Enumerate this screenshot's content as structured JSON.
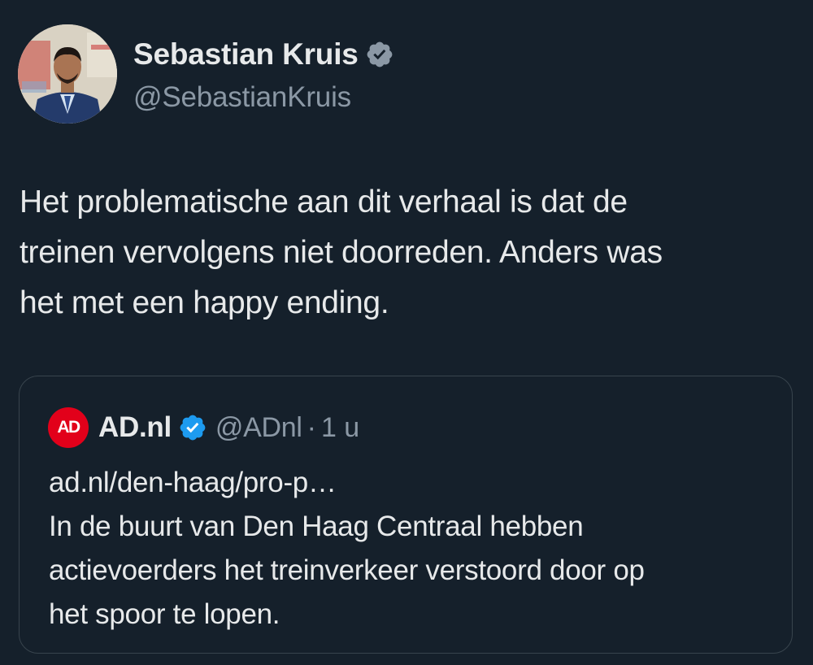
{
  "tweet": {
    "author": {
      "display_name": "Sebastian Kruis",
      "handle": "@SebastianKruis",
      "verified": true,
      "verified_color": "#8b98a5",
      "avatar_icon": "profile-photo"
    },
    "text_lines": [
      "Het problematische aan dit verhaal is dat de",
      "treinen vervolgens niet doorreden. Anders was",
      "het met een happy ending."
    ]
  },
  "quoted": {
    "logo_text": "AD",
    "logo_color": "#e2001a",
    "display_name": "AD.nl",
    "verified": true,
    "verified_color": "#1d9bf0",
    "handle": "@ADnl",
    "separator": "·",
    "time": "1 u",
    "text_lines": [
      "ad.nl/den-haag/pro-p…",
      "In de buurt van Den Haag Centraal hebben",
      "actievoerders het treinverkeer verstoord door op",
      "het spoor te lopen."
    ]
  },
  "colors": {
    "background": "#15202b",
    "text_primary": "#e7e9ea",
    "text_secondary": "#8b98a5",
    "border": "#38444d"
  }
}
